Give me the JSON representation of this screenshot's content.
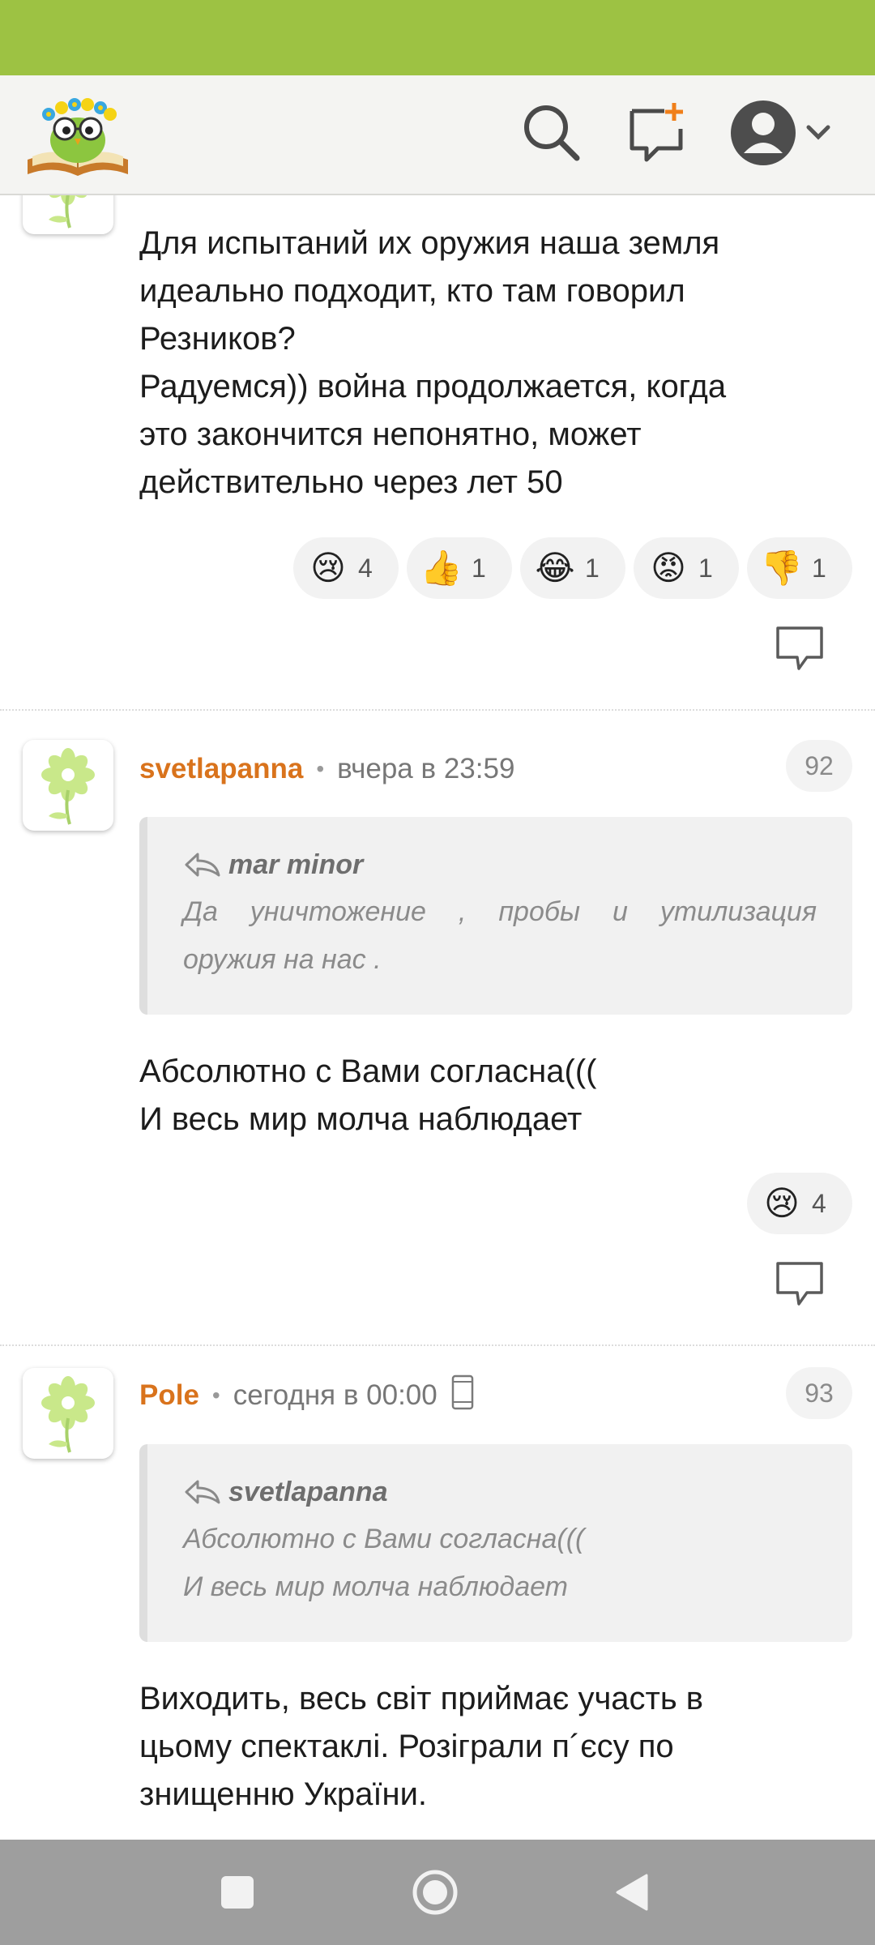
{
  "colors": {
    "status_bar": "#9dc243",
    "header_bg": "#f4f4f2",
    "author": "#d9731c",
    "nav_bar": "#9e9e9e"
  },
  "header": {
    "logo": "owl-with-book-logo",
    "icons": [
      "search-icon",
      "new-message-icon",
      "user-avatar-icon",
      "chevron-down-icon"
    ]
  },
  "comments": [
    {
      "text_lines": [
        "Для испытаний их оружия наша земля",
        "идеально подходит, кто там говорил",
        "Резников?",
        "Радуемся)) война продолжается, когда",
        "это закончится непонятно, может",
        "действительно через лет 50"
      ],
      "reactions": [
        {
          "emoji": "😢",
          "count": "4"
        },
        {
          "emoji": "👍",
          "count": "1"
        },
        {
          "emoji": "😂",
          "count": "1"
        },
        {
          "emoji": "😡",
          "count": "1"
        },
        {
          "emoji": "👎",
          "count": "1"
        }
      ]
    },
    {
      "author": "svetlapanna",
      "time": "вчера в 23:59",
      "number": "92",
      "quote": {
        "author": "mar minor",
        "lines": [
          "Да уничтожение , пробы и утилизация",
          "оружия на нас ."
        ]
      },
      "text_lines": [
        "Абсолютно с Вами согласна(((",
        "И весь мир молча наблюдает"
      ],
      "reactions": [
        {
          "emoji": "😢",
          "count": "4"
        }
      ]
    },
    {
      "author": "Pole",
      "time": "сегодня в 00:00",
      "device_icon": "mobile-phone-icon",
      "number": "93",
      "quote": {
        "author": "svetlapanna",
        "lines": [
          "Абсолютно с Вами согласна(((",
          "И весь мир молча наблюдает"
        ]
      },
      "text_lines": [
        "Виходить, весь світ приймає участь в",
        "цьому спектаклі. Розіграли п´єсу по",
        "знищенню України."
      ]
    }
  ],
  "system_nav": [
    "recent-apps-button",
    "home-button",
    "back-button"
  ]
}
